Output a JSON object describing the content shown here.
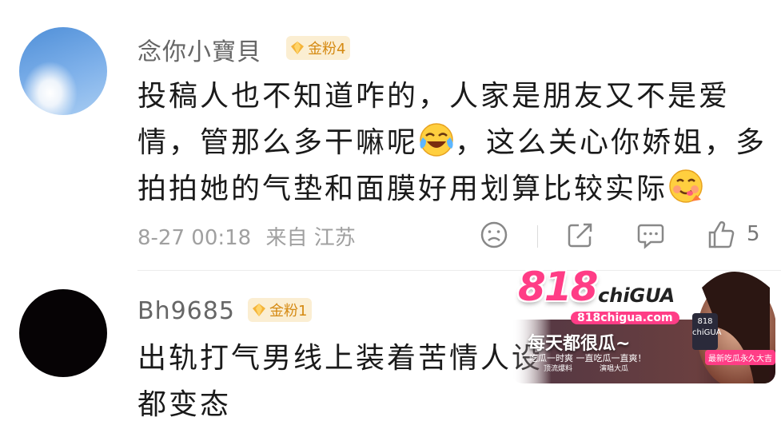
{
  "comments": [
    {
      "username": "念你小寶貝",
      "badge": "金粉4",
      "lines": [
        "投稿人也不知道咋的，人家是朋友又不是爱",
        "情，管那么多干嘛呢",
        "，这么关心你娇姐，多",
        "拍拍她的气垫和面膜好用划算比较实际"
      ],
      "emoji_1": "laugh-cry-emoji",
      "emoji_2": "yummy-emoji",
      "timestamp": "8-27 00:18",
      "location": "来自 江苏",
      "like_count": "5",
      "avatar_colors": [
        "#4f8fd8",
        "#a9cdf2"
      ]
    },
    {
      "username": "Bh9685",
      "badge": "金粉1",
      "lines": [
        "出轨打气男线上装着苦情人设",
        "都变态"
      ],
      "avatar_color": "#060305"
    }
  ],
  "ad": {
    "logo": "818",
    "brand": "chiGUA",
    "url": "818chigua.com",
    "slogan": "每天都很瓜~",
    "subline": "吃瓜一时爽 一直吃瓜一直爽！",
    "chip_1": "顶流爆料",
    "chip_2": "演唱大瓜",
    "tag": "最新吃瓜永久大吉",
    "cap": "818 chiGUA",
    "accent": "#ff3d86"
  },
  "colors": {
    "badge_bg": "#fbeed2",
    "badge_text": "#d58a13",
    "meta_text": "#a0a0a0",
    "username_text": "#666666"
  }
}
